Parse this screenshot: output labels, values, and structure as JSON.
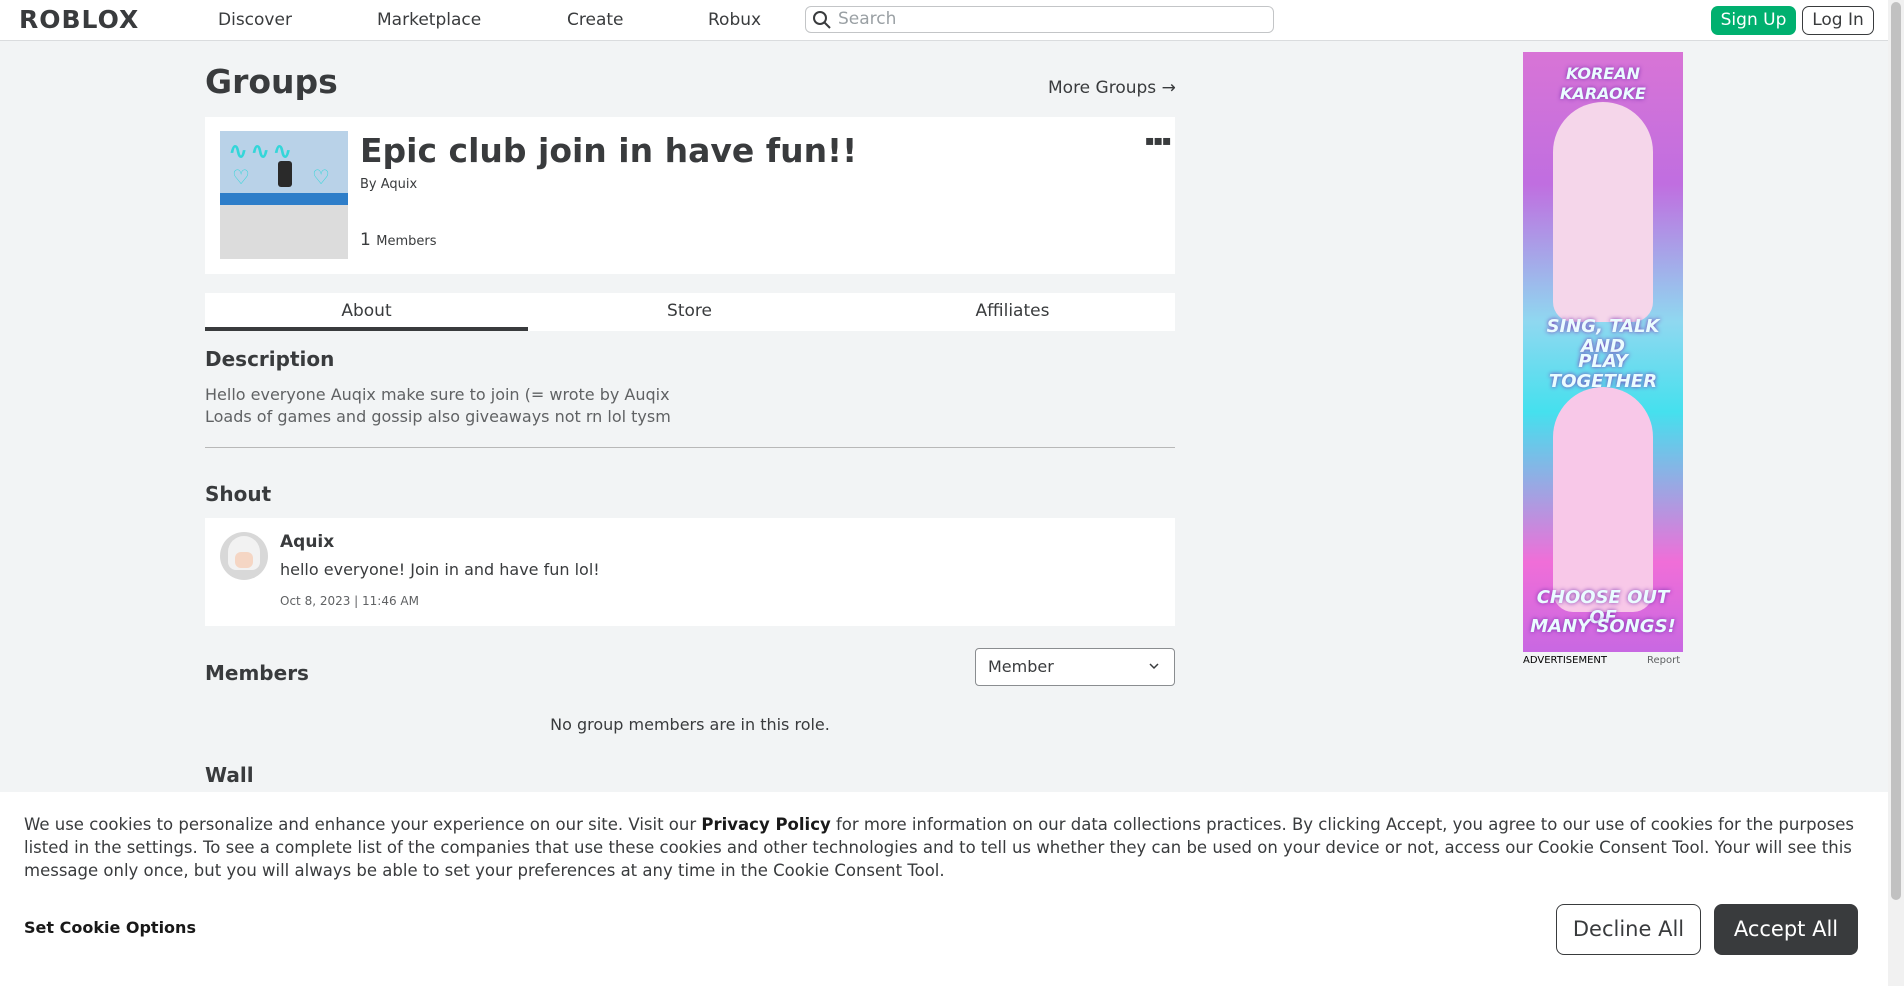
{
  "topbar": {
    "logo": "ROBLOX",
    "nav": [
      "Discover",
      "Marketplace",
      "Create",
      "Robux"
    ],
    "search_placeholder": "Search",
    "signup_label": "Sign Up",
    "login_label": "Log In"
  },
  "page": {
    "title": "Groups",
    "more_groups": "More Groups →"
  },
  "group": {
    "name": "Epic club join in have fun!!",
    "by_prefix": "By",
    "owner": "Aquix",
    "member_count": "1",
    "members_label": "Members",
    "more_menu": "▪▪▪"
  },
  "tabs": [
    {
      "label": "About",
      "active": true
    },
    {
      "label": "Store",
      "active": false
    },
    {
      "label": "Affiliates",
      "active": false
    }
  ],
  "description": {
    "heading": "Description",
    "line1": "Hello everyone Auqix make sure to join (= wrote by Auqix",
    "line2": "Loads of games and gossip also giveaways not rn lol tysm"
  },
  "shout": {
    "heading": "Shout",
    "user": "Aquix",
    "text": "hello everyone! Join in and have fun lol!",
    "date": "Oct 8, 2023 | 11:46 AM"
  },
  "members": {
    "heading": "Members",
    "role_selected": "Member",
    "empty_text": "No group members are in this role."
  },
  "wall": {
    "heading": "Wall"
  },
  "ad": {
    "top_text": "KOREAN KARAOKE",
    "mid_text_1": "SING, TALK AND",
    "mid_text_2": "PLAY TOGETHER",
    "bottom_text_1": "CHOOSE OUT OF",
    "bottom_text_2": "MANY SONGS!",
    "label": "ADVERTISEMENT",
    "report": "Report"
  },
  "cookie": {
    "text_before": "We use cookies to personalize and enhance your experience on our site. Visit our ",
    "privacy_link": "Privacy Policy",
    "text_after": " for more information on our data collections practices. By clicking Accept, you agree to our use of cookies for the purposes listed in the settings. To see a complete list of the companies that use these cookies and other technologies and to tell us whether they can be used on your device or not, access our Cookie Consent Tool. Your will see this message only once, but you will always be able to set your preferences at any time in the Cookie Consent Tool.",
    "options_label": "Set Cookie Options",
    "decline_label": "Decline All",
    "accept_label": "Accept All"
  },
  "colors": {
    "signup_green": "#00b06f",
    "text_dark": "#393b3d",
    "page_bg": "#f2f4f5"
  }
}
